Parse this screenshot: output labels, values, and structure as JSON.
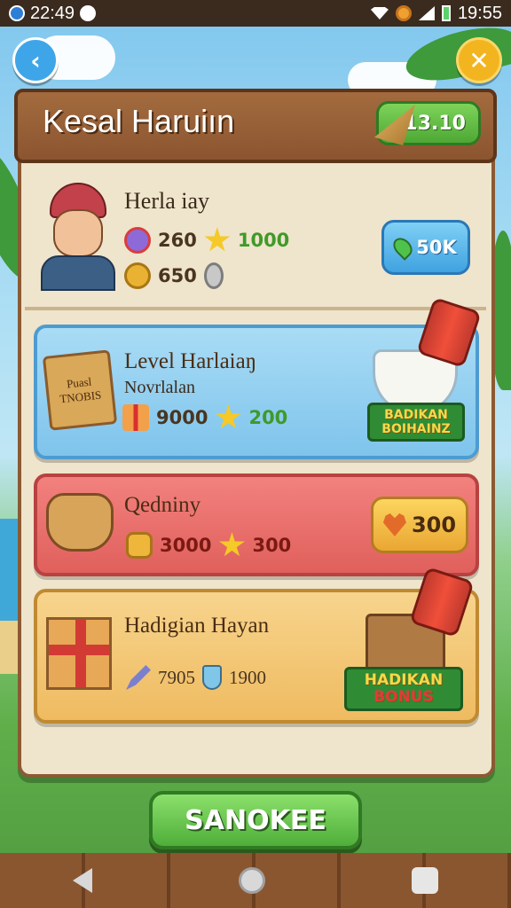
{
  "status_bar": {
    "time_left": "22:49",
    "time_right": "19:55"
  },
  "header": {
    "title": "Kesal Haruiın",
    "currency": "13.10"
  },
  "profile": {
    "name": "Herla iay",
    "stat1": "260",
    "stat1_bonus": "1000",
    "stat2": "650",
    "location_label": "50K"
  },
  "cards": [
    {
      "title": "Level Harlaiaŋ",
      "subtitle": "Novrlalan",
      "sign_line1": "Puasl",
      "sign_line2": "TNOBIS",
      "value1": "9000",
      "value2": "200",
      "ribbon_line1": "BADIKAN",
      "ribbon_line2": "BOIHAINZ"
    },
    {
      "title": "Qedniny",
      "value1": "3000",
      "value2": "300",
      "price": "300"
    },
    {
      "title": "Hadigian Hayan",
      "value1": "7905",
      "value2": "1900",
      "ribbon_line1": "HADIKAN",
      "ribbon_line2": "BONUS"
    }
  ],
  "main_button": {
    "label": "SANOKEE"
  },
  "icons": [
    "back-icon",
    "close-icon",
    "cone-icon",
    "star-icon",
    "coin-icon",
    "pin-icon",
    "heart-icon",
    "gift-icon",
    "shield-icon",
    "pencil-icon"
  ]
}
